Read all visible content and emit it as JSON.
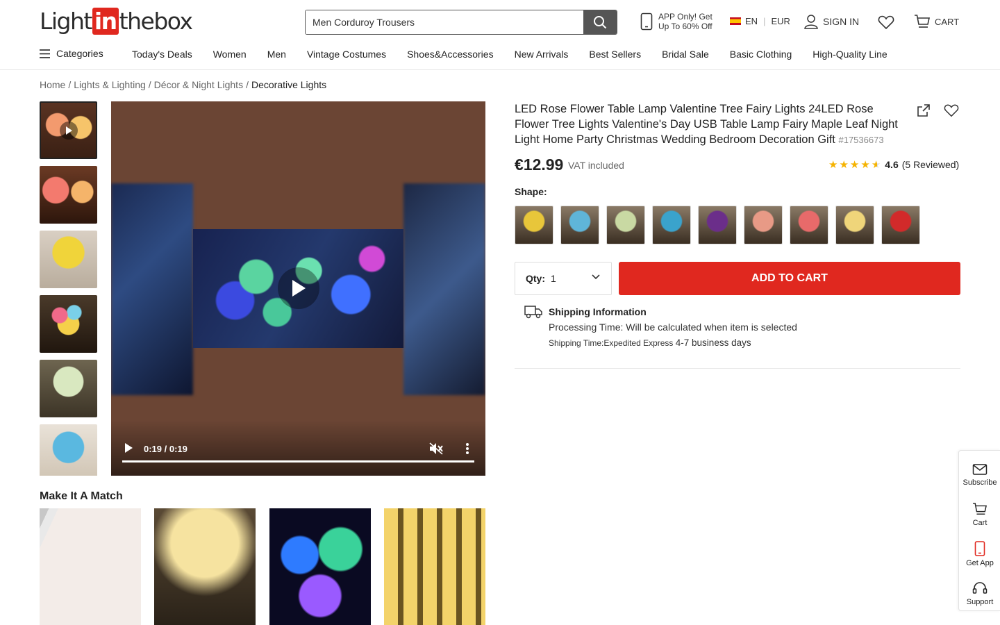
{
  "header": {
    "logo": {
      "pre": "Light",
      "in": "in",
      "post": "thebox"
    },
    "search_value": "Men Corduroy Trousers",
    "promo_line1": "APP Only! Get",
    "promo_line2": "Up To 60% Off",
    "lang": "EN",
    "currency": "EUR",
    "signin": "SIGN IN",
    "cart": "CART"
  },
  "nav": {
    "categories": "Categories",
    "items": [
      "Today's Deals",
      "Women",
      "Men",
      "Vintage Costumes",
      "Shoes&Accessories",
      "New Arrivals",
      "Best Sellers",
      "Bridal Sale",
      "Basic Clothing",
      "High-Quality Line"
    ]
  },
  "breadcrumb": [
    "Home",
    "Lights & Lighting",
    "Décor & Night Lights",
    "Decorative Lights"
  ],
  "video": {
    "time": "0:19 / 0:19",
    "progress": 1.0
  },
  "product": {
    "title": "LED Rose Flower Table Lamp Valentine Tree Fairy Lights 24LED Rose Flower Tree Lights Valentine's Day USB Table Lamp Fairy Maple Leaf Night Light Home Party Christmas Wedding Bedroom Decoration Gift",
    "sku": "#17536673",
    "price": "€12.99",
    "vat": "VAT included",
    "rating": "4.6",
    "reviews": "(5 Reviewed)",
    "stars": 4.6,
    "shape_label": "Shape:",
    "swatch_colors": [
      "#e8c63a",
      "#5fb5d9",
      "#c9d9a3",
      "#3aa3cc",
      "#6b2e8a",
      "#e89a86",
      "#e86a6a",
      "#efd57a",
      "#d22a2a"
    ],
    "qty_label": "Qty:",
    "qty_value": "1",
    "add_to_cart": "ADD TO CART",
    "shipping_title": "Shipping Information",
    "processing": "Processing Time: Will be calculated when item is selected",
    "shipping_time_label": "Shipping Time:Expedited Express",
    "shipping_days": "4-7 business days"
  },
  "match_title": "Make It A Match",
  "sidebar": {
    "subscribe": "Subscribe",
    "cart": "Cart",
    "get_app": "Get App",
    "support": "Support"
  },
  "colors": {
    "brand_red": "#e0281f",
    "star": "#f5b301"
  }
}
